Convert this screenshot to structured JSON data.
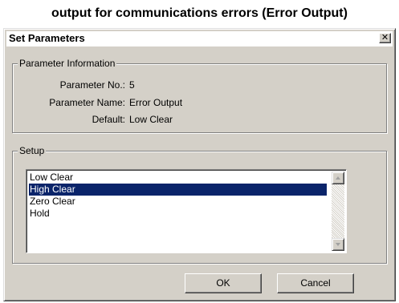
{
  "caption": "output for communications errors (Error Output)",
  "dialog": {
    "title": "Set Parameters",
    "close_glyph": "✕"
  },
  "parameter_info": {
    "legend": "Parameter Information",
    "rows": [
      {
        "label": "Parameter No.:",
        "value": "5"
      },
      {
        "label": "Parameter Name:",
        "value": "Error Output"
      },
      {
        "label": "Default:",
        "value": "Low Clear"
      }
    ]
  },
  "setup": {
    "legend": "Setup",
    "options": [
      "Low Clear",
      "High Clear",
      "Zero Clear",
      "Hold"
    ],
    "selected": "High Clear"
  },
  "buttons": {
    "ok": "OK",
    "cancel": "Cancel"
  },
  "colors": {
    "dialog_bg": "#d4d0c8",
    "selection": "#0a246a",
    "listbox_bg": "#ffffff"
  }
}
